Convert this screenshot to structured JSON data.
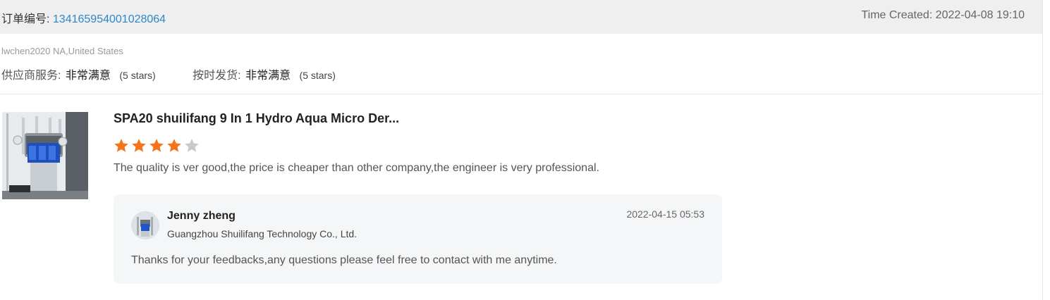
{
  "order": {
    "label": "订单编号: ",
    "number": "134165954001028064",
    "time_created": "Time Created: 2022-04-08 19:10"
  },
  "buyer": {
    "info": "lwchen2020 NA,United States"
  },
  "ratings": [
    {
      "label": "供应商服务:",
      "value": "非常满意",
      "stars_text": "(5 stars)"
    },
    {
      "label": "按时发货:",
      "value": "非常满意",
      "stars_text": "(5 stars)"
    }
  ],
  "product": {
    "title": "SPA20 shuilifang 9 In 1 Hydro Aqua Micro Der...",
    "rating": 4,
    "rating_max": 5,
    "review": "The quality is ver good,the price is cheaper than other company,the engineer is very professional."
  },
  "reply": {
    "name": "Jenny zheng",
    "company": "Guangzhou Shuilifang Technology Co., Ltd.",
    "date": "2022-04-15 05:53",
    "text": "Thanks for your feedbacks,any questions please feel free to contact with me anytime."
  },
  "colors": {
    "star_filled": "#f5741b",
    "star_empty": "#c8c8cf",
    "link": "#2f87c8"
  },
  "icons": {
    "star": "star-icon",
    "product_image": "product-thumbnail",
    "avatar": "avatar"
  }
}
